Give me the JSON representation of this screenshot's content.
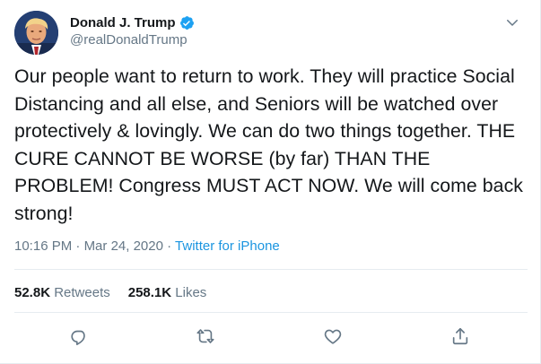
{
  "tweet": {
    "display_name": "Donald J. Trump",
    "handle": "@realDonaldTrump",
    "verified": true,
    "text": "Our people want to return to work. They will practice Social Distancing and all else, and Seniors will be watched over protectively & lovingly. We can do two things together. THE CURE CANNOT BE WORSE (by far) THAN THE PROBLEM! Congress MUST ACT NOW. We will come back strong!",
    "time": "10:16 PM",
    "date": "Mar 24, 2020",
    "separator": "·",
    "source": "Twitter for iPhone",
    "retweets_count": "52.8K",
    "retweets_label": "Retweets",
    "likes_count": "258.1K",
    "likes_label": "Likes"
  },
  "icons": {
    "verified": "verified-badge-icon",
    "caret": "chevron-down-icon",
    "reply": "reply-icon",
    "retweet": "retweet-icon",
    "like": "heart-icon",
    "share": "share-icon"
  },
  "colors": {
    "text_primary": "#14171a",
    "text_secondary": "#657786",
    "accent": "#1b95e0",
    "divider": "#e6ecf0",
    "verified": "#1da1f2"
  }
}
